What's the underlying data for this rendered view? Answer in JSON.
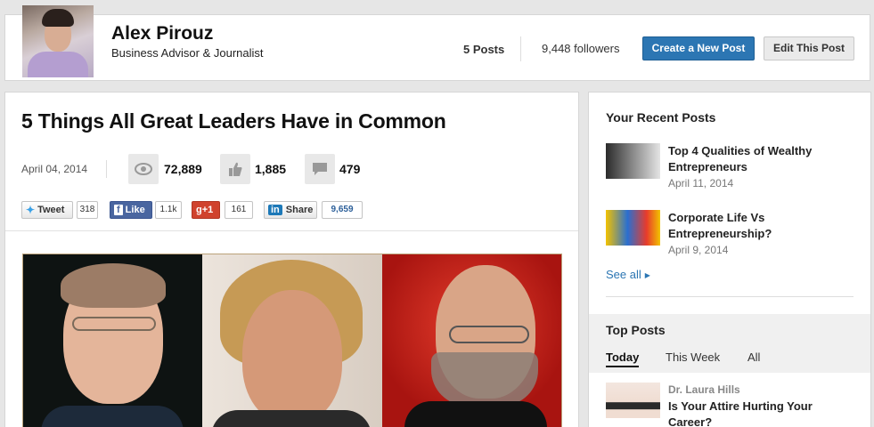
{
  "profile": {
    "name": "Alex Pirouz",
    "title": "Business Advisor & Journalist",
    "posts": "5 Posts",
    "followers": "9,448 followers",
    "create_button": "Create a New Post",
    "edit_button": "Edit This Post"
  },
  "article": {
    "title": "5 Things All Great Leaders Have in Common",
    "date": "April 04, 2014",
    "views": "72,889",
    "likes": "1,885",
    "comments": "479",
    "share": {
      "tweet_label": "Tweet",
      "tweet_count": "318",
      "fb_label": "Like",
      "fb_count": "1.1k",
      "gplus_label": "+1",
      "gplus_count": "161",
      "linkedin_label": "Share",
      "linkedin_count": "9,659"
    }
  },
  "sidebar": {
    "recent_heading": "Your Recent Posts",
    "recent": [
      {
        "title": "Top 4 Qualities of Wealthy Entrepreneurs",
        "date": "April 11, 2014"
      },
      {
        "title": "Corporate Life Vs Entrepreneurship?",
        "date": "April 9, 2014"
      }
    ],
    "see_all": "See all",
    "top_heading": "Top Posts",
    "tabs": [
      "Today",
      "This Week",
      "All"
    ],
    "top_post": {
      "author": "Dr. Laura Hills",
      "title": "Is Your Attire Hurting Your Career?"
    }
  },
  "colors": {
    "accent": "#2c76b3",
    "facebook": "#4a66a0",
    "gplus": "#d0422d"
  }
}
